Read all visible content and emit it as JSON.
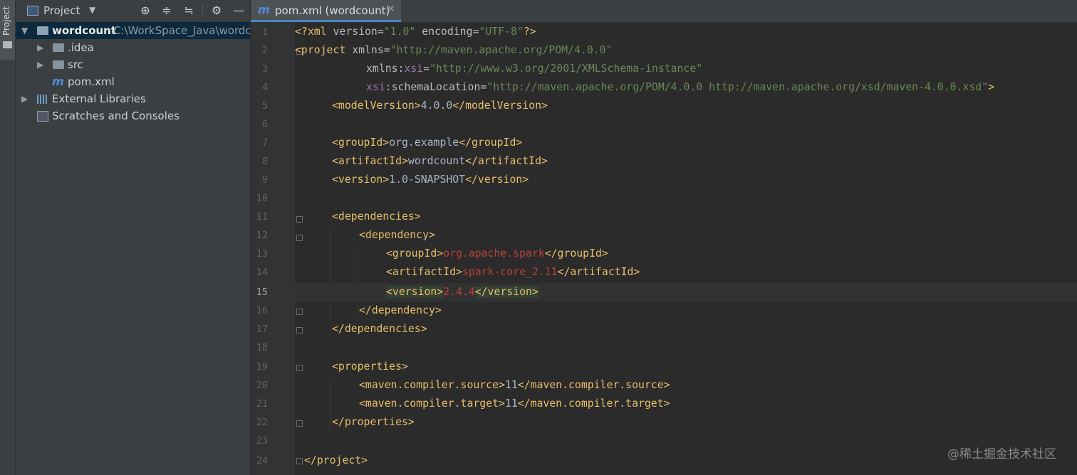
{
  "sidebar_strip": {
    "label": "Project"
  },
  "project_panel": {
    "title": "Project",
    "tree": [
      {
        "label": "wordcount",
        "path": "C:\\WorkSpace_Java\\wordco",
        "kind": "root-folder"
      },
      {
        "label": ".idea",
        "kind": "folder"
      },
      {
        "label": "src",
        "kind": "folder"
      },
      {
        "label": "pom.xml",
        "kind": "maven-file"
      },
      {
        "label": "External Libraries",
        "kind": "library"
      },
      {
        "label": "Scratches and Consoles",
        "kind": "scratch"
      }
    ]
  },
  "editor_tab": {
    "title": "pom.xml (wordcount)",
    "icon": "m"
  },
  "current_line": 15,
  "line_numbers": [
    "1",
    "2",
    "3",
    "4",
    "5",
    "6",
    "7",
    "8",
    "9",
    "10",
    "11",
    "12",
    "13",
    "14",
    "15",
    "16",
    "17",
    "18",
    "19",
    "20",
    "21",
    "22",
    "23",
    "24"
  ],
  "code": {
    "l1": {
      "a": "<?",
      "b": "xml ",
      "c": "version",
      "d": "=",
      "e": "\"1.0\"",
      "f": " encoding",
      "g": "=",
      "h": "\"UTF-8\"",
      "i": "?>"
    },
    "l2": {
      "a": "<project ",
      "b": "xmlns",
      "c": "=",
      "d": "\"http://maven.apache.org/POM/4.0.0\""
    },
    "l3": {
      "a": "xmlns",
      "b": ":",
      "c": "xsi",
      "d": "=",
      "e": "\"http://www.w3.org/2001/XMLSchema-instance\""
    },
    "l4": {
      "a": "xsi",
      "b": ":schemaLocation",
      "c": "=",
      "d": "\"http://maven.apache.org/POM/4.0.0 http://maven.apache.org/xsd/maven-4.0.0.xsd\"",
      "e": ">"
    },
    "l5": {
      "a": "<modelVersion>",
      "b": "4.0.0",
      "c": "</modelVersion>"
    },
    "l7": {
      "a": "<groupId>",
      "b": "org.example",
      "c": "</groupId>"
    },
    "l8": {
      "a": "<artifactId>",
      "b": "wordcount",
      "c": "</artifactId>"
    },
    "l9": {
      "a": "<version>",
      "b": "1.0-SNAPSHOT",
      "c": "</version>"
    },
    "l11": {
      "a": "<dependencies>"
    },
    "l12": {
      "a": "<dependency>"
    },
    "l13": {
      "a": "<groupId>",
      "b": "org.apache.spark",
      "c": "</groupId>"
    },
    "l14": {
      "a": "<artifactId>",
      "b": "spark-core_2.11",
      "c": "</artifactId>"
    },
    "l15": {
      "a": "<version>",
      "b": "2.4.4",
      "c": "</version>"
    },
    "l16": {
      "a": "</dependency>"
    },
    "l17": {
      "a": "</dependencies>"
    },
    "l19": {
      "a": "<properties>"
    },
    "l20": {
      "a": "<maven.compiler.source>",
      "b": "11",
      "c": "</maven.compiler.source>"
    },
    "l21": {
      "a": "<maven.compiler.target>",
      "b": "11",
      "c": "</maven.compiler.target>"
    },
    "l22": {
      "a": "</properties>"
    },
    "l24": {
      "a": "</project>"
    }
  },
  "watermark": "@稀土掘金技术社区",
  "colors": {
    "tag": "#e8bf6a",
    "string": "#6a8759",
    "error_text": "#bc3f3c",
    "namespace": "#9876aa",
    "selection": "#0d293e",
    "tab_underline": "#4a88c7"
  }
}
